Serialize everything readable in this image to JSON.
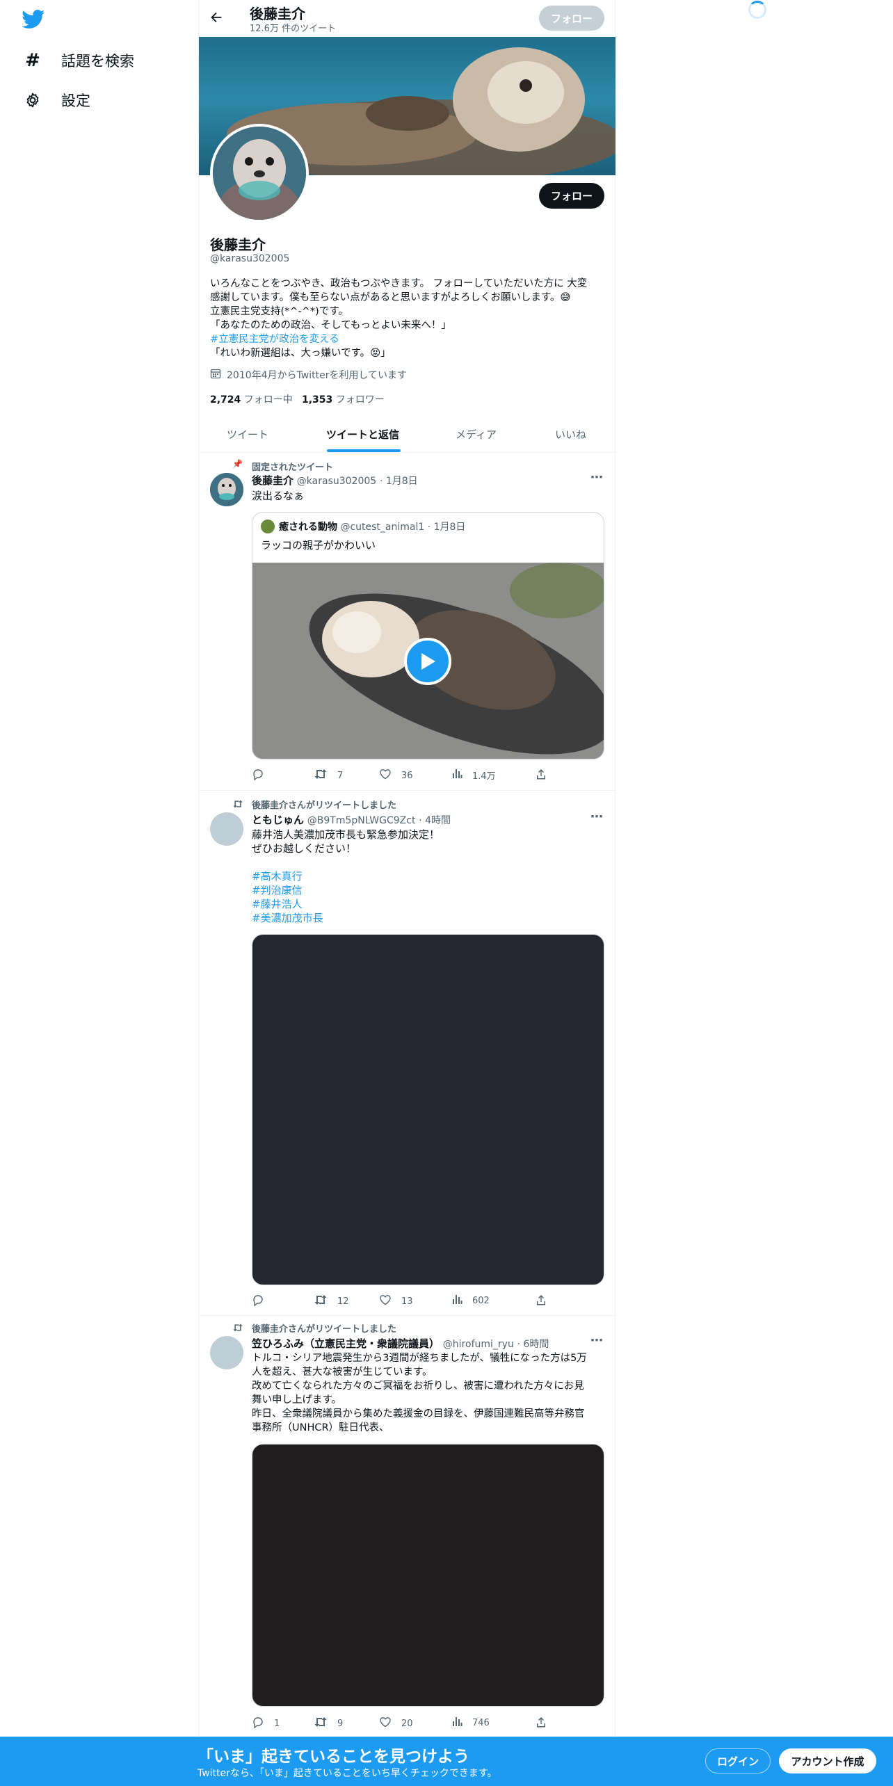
{
  "nav": {
    "explore_label": "話題を検索",
    "settings_label": "設定"
  },
  "header": {
    "name": "後藤圭介",
    "tweet_count": "12.6万 件のツイート",
    "follow_label": "フォロー"
  },
  "profile": {
    "name": "後藤圭介",
    "handle": "@karasu302005",
    "follow_label": "フォロー",
    "bio_line1": "いろんなことをつぶやき、政治もつぶやきます。 フォローしていただいた方に 大変",
    "bio_line2": "感謝しています。僕も至らない点があると思いますがよろしくお願いします。😅",
    "bio_line3": "立憲民主党支持(*^-^*)です。",
    "bio_line4": "「あなたのための政治、そしてもっとよい未来へ！」",
    "bio_hashtag": "#立憲民主党が政治を変える",
    "bio_line6": "「れいわ新選組は、大っ嫌いです。😡」",
    "joined": "2010年4月からTwitterを利用しています",
    "following_count": "2,724",
    "following_label": "フォロー中",
    "followers_count": "1,353",
    "followers_label": "フォロワー"
  },
  "tabs": [
    {
      "label": "ツイート",
      "active": false
    },
    {
      "label": "ツイートと返信",
      "active": true
    },
    {
      "label": "メディア",
      "active": false
    },
    {
      "label": "いいね",
      "active": false
    }
  ],
  "tweets": [
    {
      "context": "固定されたツイート",
      "name": "後藤圭介",
      "handle": "@karasu302005",
      "time": "· 1月8日",
      "text": "涙出るなぁ",
      "quote": {
        "name": "癒される動物",
        "handle": "@cutest_animal1",
        "time": "· 1月8日",
        "text": "ラッコの親子がかわいい"
      },
      "replies": "",
      "retweets": "7",
      "likes": "36",
      "views": "1.4万"
    },
    {
      "context": "後藤圭介さんがリツイートしました",
      "name": "ともじゅん",
      "handle": "@B9Tm5pNLWGC9Zct",
      "time": "· 4時間",
      "text1": "藤井浩人美濃加茂市長も緊急参加決定！",
      "text2": "ぜひお越しください！",
      "hashtags": [
        "#高木真行",
        "#判治康信",
        "#藤井浩人",
        "#美濃加茂市長"
      ],
      "replies": "",
      "retweets": "12",
      "likes": "13",
      "views": "602"
    },
    {
      "context": "後藤圭介さんがリツイートしました",
      "name": "笠ひろふみ（立憲民主党・衆議院議員）",
      "handle": "@hirofumi_ryu",
      "time": "· 6時間",
      "line1": "トルコ・シリア地震発生から3週間が経ちましたが、犠牲になった方は5万",
      "line2": "人を超え、甚大な被害が生じています。",
      "line3": "改めて亡くなられた方々のご冥福をお祈りし、被害に遭われた方々にお見",
      "line4": "舞い申し上げます。",
      "line5": "昨日、全衆議院議員から集めた義援金の目録を、伊藤国連難民高等弁務官",
      "line6": "事務所（UNHCR）駐日代表、",
      "replies": "1",
      "retweets": "9",
      "likes": "20",
      "views": "746"
    }
  ],
  "bottom_bar": {
    "headline": "「いま」起きていることを見つけよう",
    "sub": "Twitterなら、「いま」起きていることをいち早くチェックできます。",
    "login_label": "ログイン",
    "signup_label": "アカウント作成"
  },
  "colors": {
    "accent": "#1d9bf0",
    "text": "#0f1419",
    "muted": "#536471",
    "border": "#eff3f4"
  }
}
